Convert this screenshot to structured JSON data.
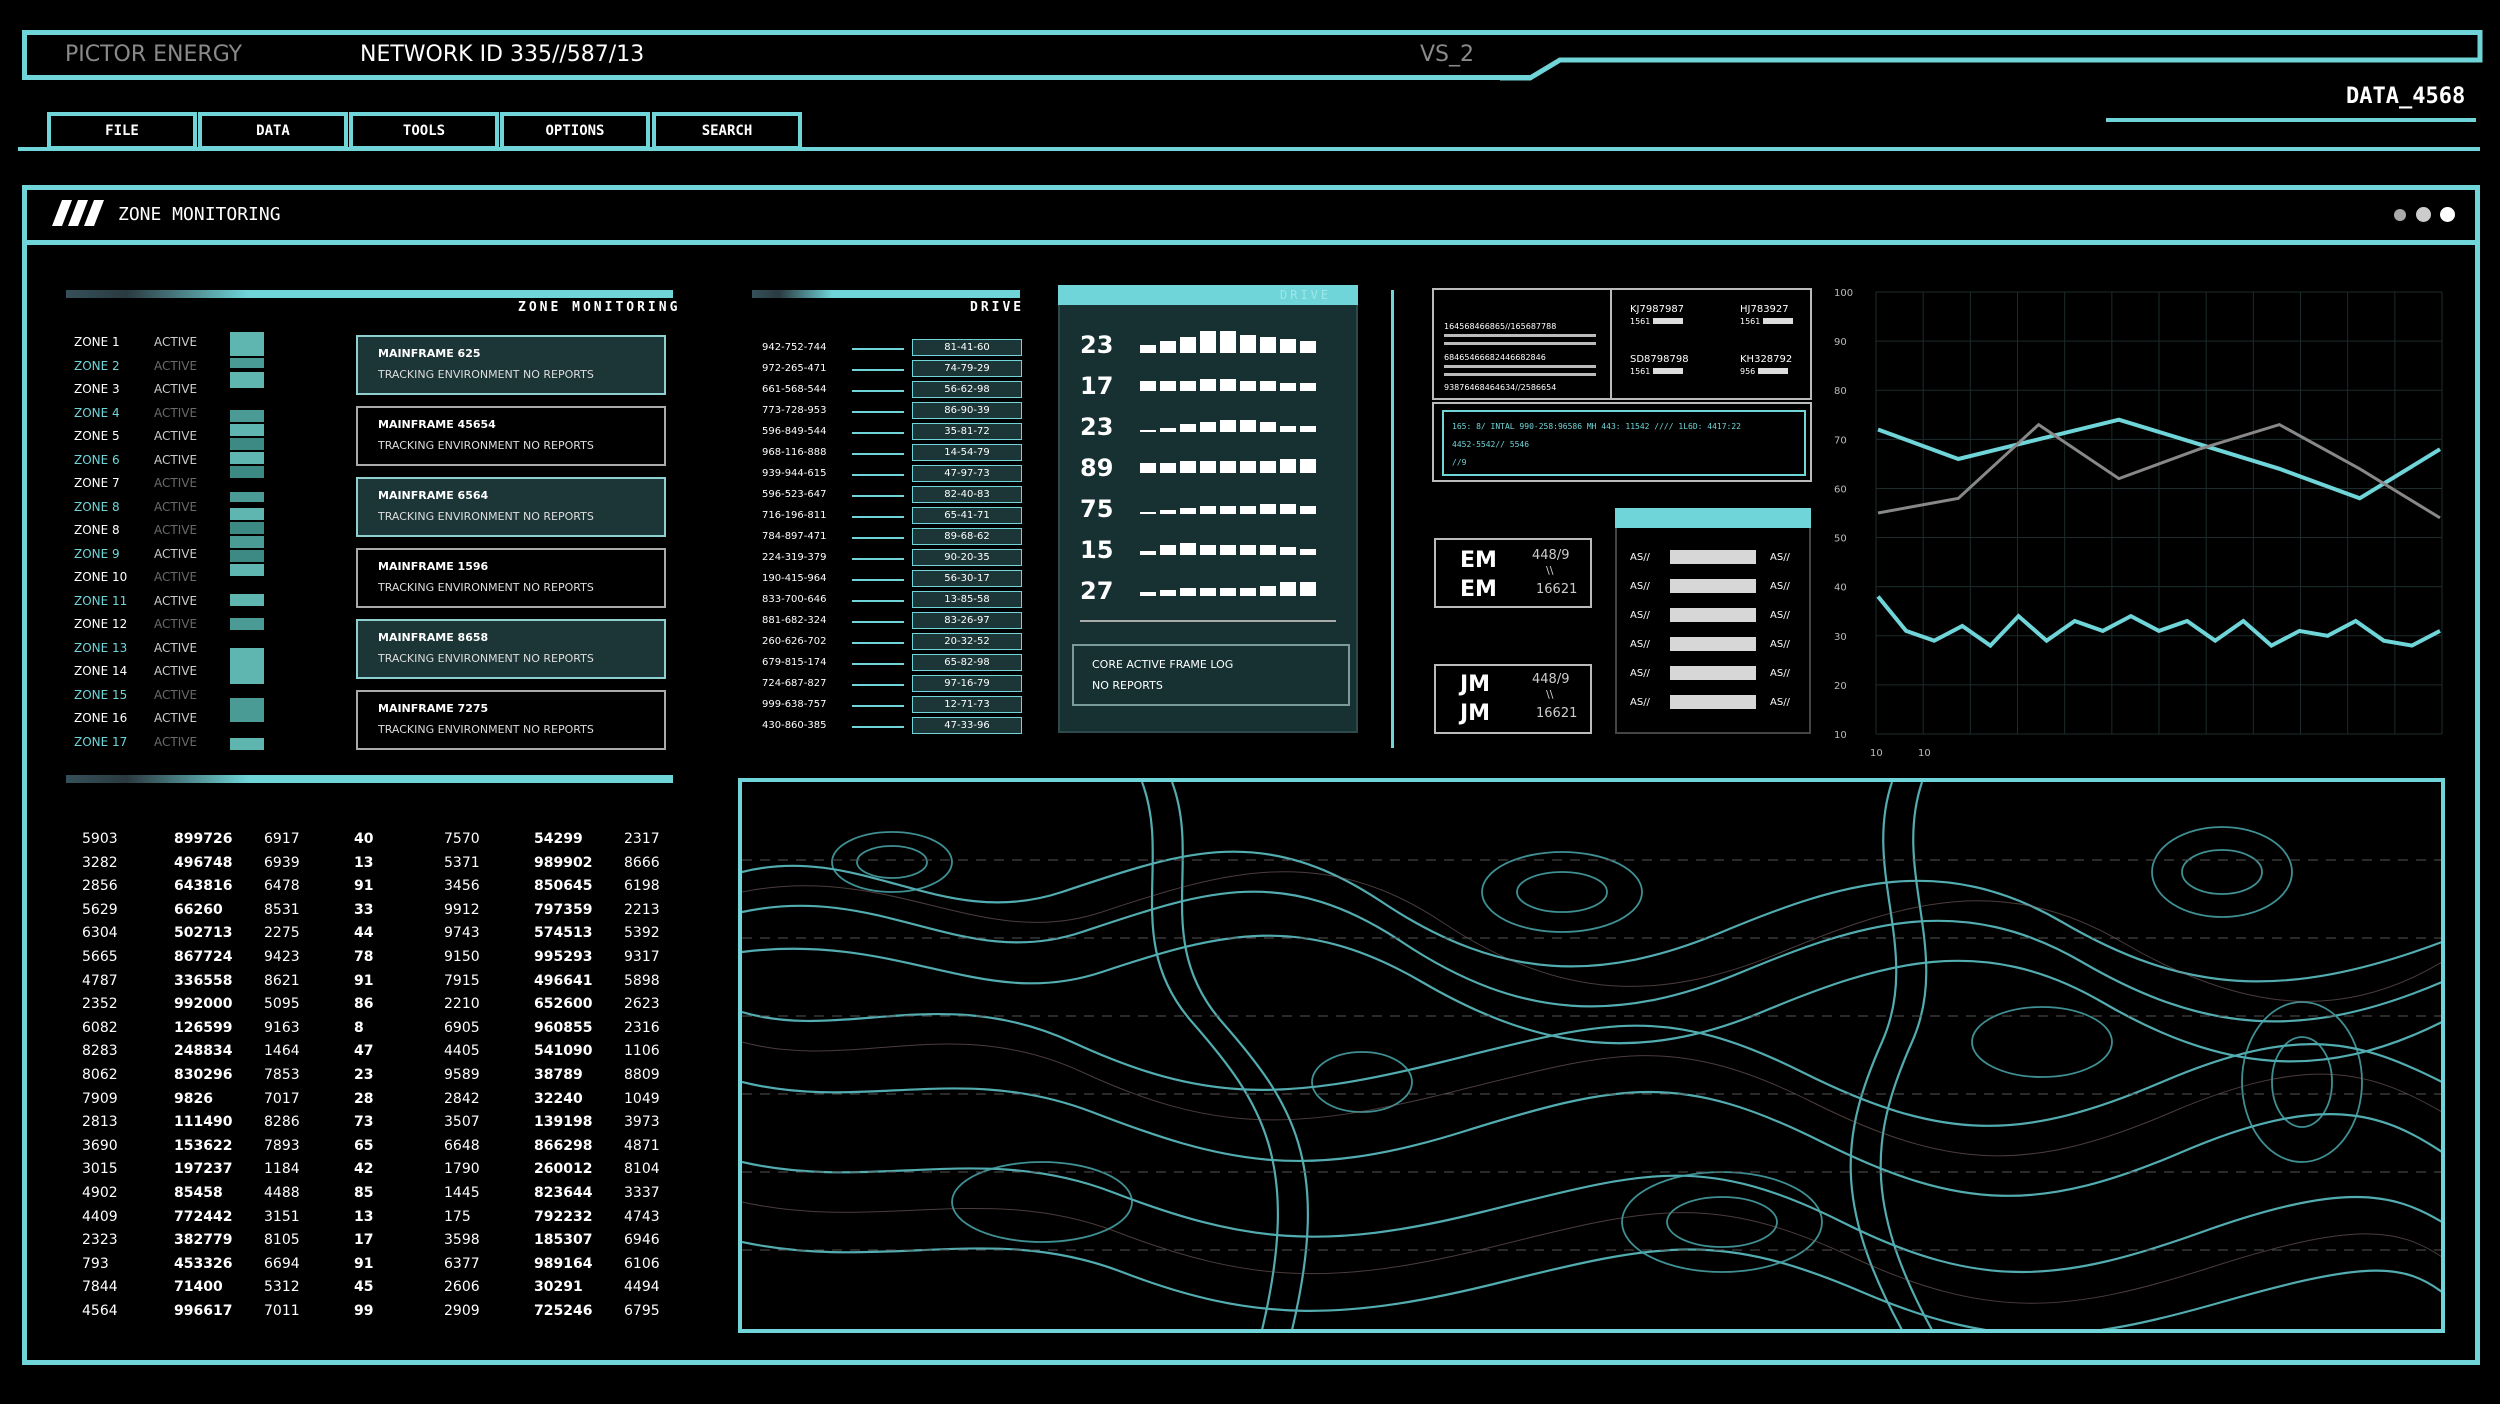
{
  "header": {
    "brand": "PICTOR ENERGY",
    "network_id": "NETWORK ID 335//587/13",
    "version": "VS_2",
    "data_id": "DATA_4568"
  },
  "menu": [
    {
      "label": "FILE"
    },
    {
      "label": "DATA"
    },
    {
      "label": "TOOLS"
    },
    {
      "label": "OPTIONS"
    },
    {
      "label": "SEARCH"
    }
  ],
  "window": {
    "title": "ZONE MONITORING"
  },
  "zone_panel": {
    "title": "ZONE MONITORING",
    "zones": [
      {
        "name": "ZONE 1",
        "status": "ACTIVE"
      },
      {
        "name": "ZONE 2",
        "status": "ACTIVE"
      },
      {
        "name": "ZONE 3",
        "status": "ACTIVE"
      },
      {
        "name": "ZONE 4",
        "status": "ACTIVE"
      },
      {
        "name": "ZONE 5",
        "status": "ACTIVE"
      },
      {
        "name": "ZONE 6",
        "status": "ACTIVE"
      },
      {
        "name": "ZONE 7",
        "status": "ACTIVE"
      },
      {
        "name": "ZONE 8",
        "status": "ACTIVE"
      },
      {
        "name": "ZONE 8",
        "status": "ACTIVE"
      },
      {
        "name": "ZONE 9",
        "status": "ACTIVE"
      },
      {
        "name": "ZONE 10",
        "status": "ACTIVE"
      },
      {
        "name": "ZONE 11",
        "status": "ACTIVE"
      },
      {
        "name": "ZONE 12",
        "status": "ACTIVE"
      },
      {
        "name": "ZONE 13",
        "status": "ACTIVE"
      },
      {
        "name": "ZONE 14",
        "status": "ACTIVE"
      },
      {
        "name": "ZONE 15",
        "status": "ACTIVE"
      },
      {
        "name": "ZONE 16",
        "status": "ACTIVE"
      },
      {
        "name": "ZONE 17",
        "status": "ACTIVE"
      }
    ],
    "mainframes": [
      {
        "name": "MAINFRAME 625",
        "status": "TRACKING ENVIRONMENT NO REPORTS"
      },
      {
        "name": "MAINFRAME 45654",
        "status": "TRACKING ENVIRONMENT NO REPORTS"
      },
      {
        "name": "MAINFRAME 6564",
        "status": "TRACKING ENVIRONMENT NO REPORTS"
      },
      {
        "name": "MAINFRAME 1596",
        "status": "TRACKING ENVIRONMENT NO REPORTS"
      },
      {
        "name": "MAINFRAME 8658",
        "status": "TRACKING ENVIRONMENT NO REPORTS"
      },
      {
        "name": "MAINFRAME 7275",
        "status": "TRACKING ENVIRONMENT NO REPORTS"
      }
    ]
  },
  "drive_list": {
    "title": "DRIVE",
    "rows": [
      {
        "left": "942-752-744",
        "right": "81-41-60"
      },
      {
        "left": "972-265-471",
        "right": "74-79-29"
      },
      {
        "left": "661-568-544",
        "right": "56-62-98"
      },
      {
        "left": "773-728-953",
        "right": "86-90-39"
      },
      {
        "left": "596-849-544",
        "right": "35-81-72"
      },
      {
        "left": "968-116-888",
        "right": "14-54-79"
      },
      {
        "left": "939-944-615",
        "right": "47-97-73"
      },
      {
        "left": "596-523-647",
        "right": "82-40-83"
      },
      {
        "left": "716-196-811",
        "right": "65-41-71"
      },
      {
        "left": "784-897-471",
        "right": "89-68-62"
      },
      {
        "left": "224-319-379",
        "right": "90-20-35"
      },
      {
        "left": "190-415-964",
        "right": "56-30-17"
      },
      {
        "left": "833-700-646",
        "right": "13-85-58"
      },
      {
        "left": "881-682-324",
        "right": "83-26-97"
      },
      {
        "left": "260-626-702",
        "right": "20-32-52"
      },
      {
        "left": "679-815-174",
        "right": "65-82-98"
      },
      {
        "left": "724-687-827",
        "right": "97-16-79"
      },
      {
        "left": "999-638-757",
        "right": "12-71-73"
      },
      {
        "left": "430-860-385",
        "right": "47-33-96"
      }
    ]
  },
  "drive_panel": {
    "title": "DRIVE",
    "numbers": [
      "23",
      "17",
      "23",
      "89",
      "75",
      "15",
      "27"
    ],
    "log_title": "CORE ACTIVE FRAME LOG",
    "log_status": "NO REPORTS"
  },
  "info_panel": {
    "codes_left": [
      "164568466865//165687788",
      "68465466682446682846",
      "93876468464634//2586654"
    ],
    "codes_right": [
      {
        "id": "KJ7987987",
        "num": "1561"
      },
      {
        "id": "HJ783927",
        "num": "1561"
      },
      {
        "id": "SD8798798",
        "num": "1561"
      },
      {
        "id": "KH328792",
        "num": "956"
      }
    ],
    "console_line1": "165: 8/ INTAL 990-258:96586 MH 443: 11542 //// 1L6D: 4417:22",
    "console_line2": "4452-5542// 5546",
    "console_line3": "//9",
    "em_label": "EM",
    "em_value": "448/9",
    "em_sep": "\\\\",
    "em_code": "16621",
    "jm_label": "JM",
    "jm_value": "448/9",
    "jm_sep": "\\\\",
    "jm_code": "16621",
    "as_label": "AS//",
    "as_count": 6
  },
  "chart_data": {
    "type": "line",
    "ylim": [
      10,
      100
    ],
    "y_ticks": [
      "100",
      "90",
      "80",
      "70",
      "60",
      "50",
      "40",
      "30",
      "20",
      "10"
    ],
    "x_ticks": [
      "10",
      "10"
    ],
    "series": [
      {
        "color": "#6fd5d8",
        "values": [
          72,
          66,
          70,
          74,
          69,
          64,
          58,
          68
        ]
      },
      {
        "color": "#888888",
        "values": [
          55,
          58,
          73,
          62,
          68,
          73,
          64,
          54
        ]
      },
      {
        "color": "#6fd5d8",
        "values": [
          38,
          31,
          29,
          32,
          28,
          34,
          29,
          33,
          31,
          34,
          31,
          33,
          29,
          33,
          28,
          31,
          30,
          33,
          29,
          28,
          31
        ]
      }
    ]
  },
  "data_table": {
    "columns": [
      [
        "5903",
        "3282",
        "2856",
        "5629",
        "6304",
        "5665",
        "4787",
        "2352",
        "6082",
        "8283",
        "8062",
        "7909",
        "2813",
        "3690",
        "3015",
        "4902",
        "4409",
        "2323",
        "793",
        "7844",
        "4564"
      ],
      [
        "899726",
        "496748",
        "643816",
        "66260",
        "502713",
        "867724",
        "336558",
        "992000",
        "126599",
        "248834",
        "830296",
        "9826",
        "111490",
        "153622",
        "197237",
        "85458",
        "772442",
        "382779",
        "453326",
        "71400",
        "996617"
      ],
      [
        "6917",
        "6939",
        "6478",
        "8531",
        "2275",
        "9423",
        "8621",
        "5095",
        "9163",
        "1464",
        "7853",
        "7017",
        "8286",
        "7893",
        "1184",
        "4488",
        "3151",
        "8105",
        "6694",
        "5312",
        "7011"
      ],
      [
        "40",
        "13",
        "91",
        "33",
        "44",
        "78",
        "91",
        "86",
        "8",
        "47",
        "23",
        "28",
        "73",
        "65",
        "42",
        "85",
        "13",
        "17",
        "91",
        "45",
        "99"
      ],
      [
        "7570",
        "5371",
        "3456",
        "9912",
        "9743",
        "9150",
        "7915",
        "2210",
        "6905",
        "4405",
        "9589",
        "2842",
        "3507",
        "6648",
        "1790",
        "1445",
        "175",
        "3598",
        "6377",
        "2606",
        "2909"
      ],
      [
        "54299",
        "989902",
        "850645",
        "797359",
        "574513",
        "995293",
        "496641",
        "652600",
        "960855",
        "541090",
        "38789",
        "32240",
        "139198",
        "866298",
        "260012",
        "823644",
        "792232",
        "185307",
        "989164",
        "30291",
        "725246"
      ],
      [
        "2317",
        "8666",
        "6198",
        "2213",
        "5392",
        "9317",
        "5898",
        "2623",
        "2316",
        "1106",
        "8809",
        "1049",
        "3973",
        "4871",
        "8104",
        "3337",
        "4743",
        "6946",
        "6106",
        "4494",
        "6795"
      ]
    ]
  }
}
